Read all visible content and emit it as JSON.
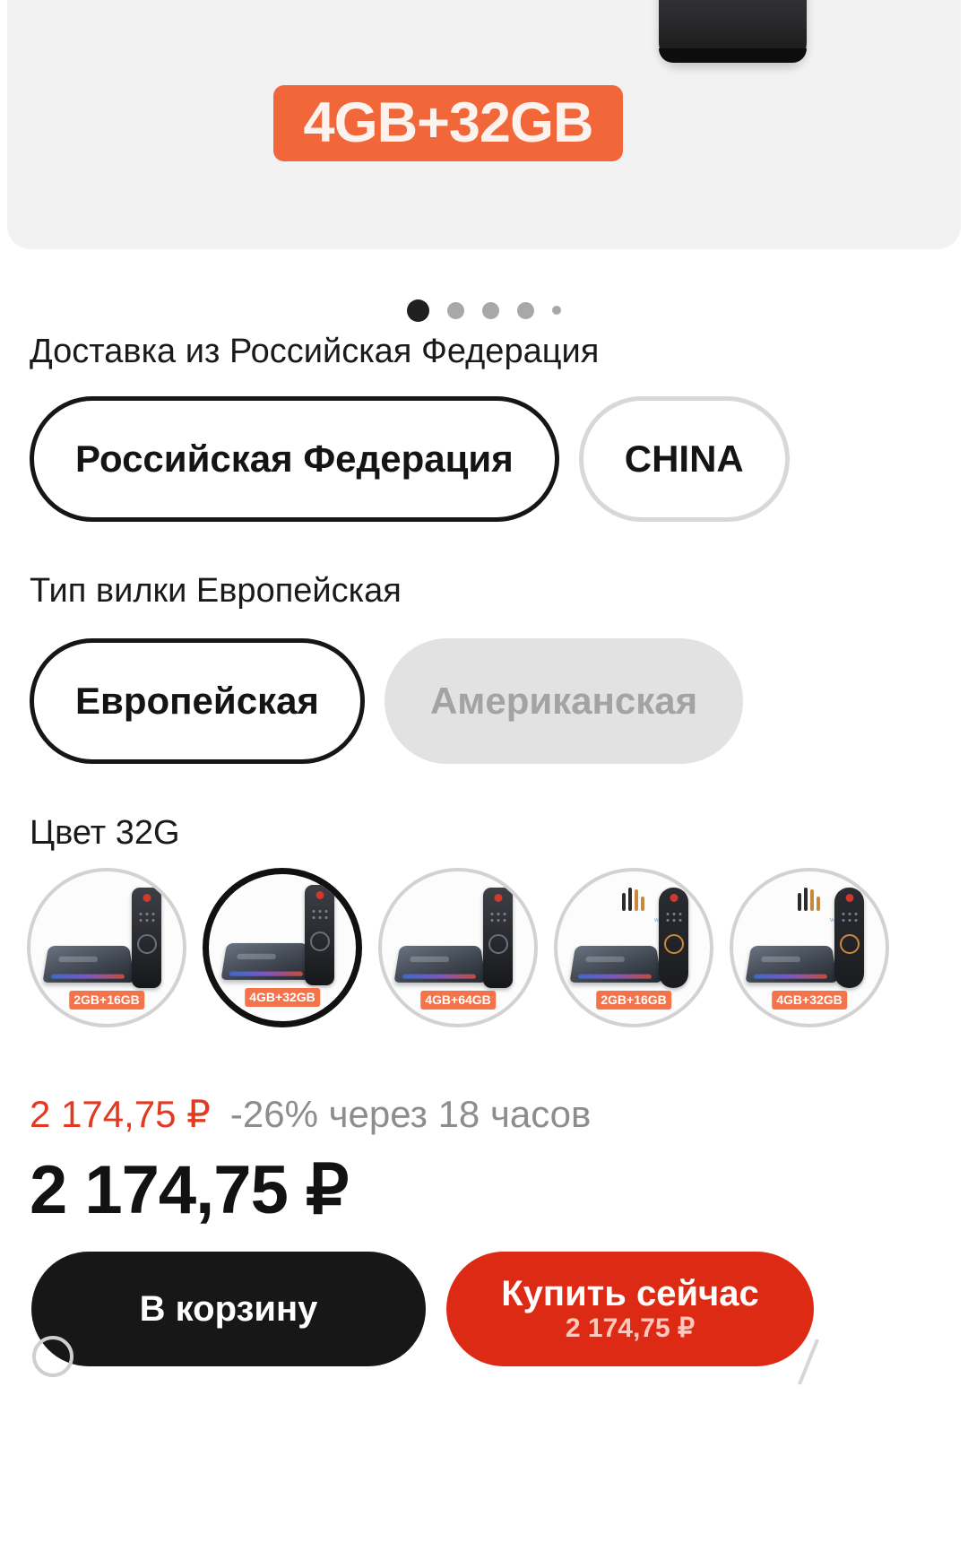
{
  "gallery": {
    "spec_badge": "4GB+32GB",
    "device_icon": "tv-box-device",
    "dots": [
      {
        "state": "active"
      },
      {
        "state": "inactive"
      },
      {
        "state": "inactive"
      },
      {
        "state": "inactive"
      },
      {
        "state": "edge"
      }
    ]
  },
  "delivery": {
    "label": "Доставка из Российская Федерация",
    "options": [
      {
        "label": "Российская Федерация",
        "selected": true,
        "muted": false
      },
      {
        "label": "CHINA",
        "selected": false,
        "muted": false
      }
    ]
  },
  "plug": {
    "label": "Тип вилки Европейская",
    "options": [
      {
        "label": "Европейская",
        "selected": true,
        "muted": false
      },
      {
        "label": "Американская",
        "selected": false,
        "muted": true
      }
    ]
  },
  "color": {
    "label": "Цвет 32G",
    "options": [
      {
        "badge": "2GB+16GB",
        "selected": false,
        "kind": "ir"
      },
      {
        "badge": "4GB+32GB",
        "selected": true,
        "kind": "ir"
      },
      {
        "badge": "4GB+64GB",
        "selected": false,
        "kind": "ir"
      },
      {
        "badge": "2GB+16GB",
        "selected": false,
        "kind": "voice"
      },
      {
        "badge": "4GB+32GB",
        "selected": false,
        "kind": "voice"
      }
    ]
  },
  "price": {
    "promo_price": "2 174,75 ₽",
    "promo_note": "-26% через 18 часов",
    "main_price": "2 174,75 ₽"
  },
  "actions": {
    "cart_label": "В корзину",
    "buy_label": "Купить сейчас",
    "buy_price": "2 174,75 ₽"
  },
  "colors": {
    "accent_orange": "#f2673a",
    "buy_red": "#dd2a14",
    "promo_red": "#e03b22",
    "cart_black": "#171717",
    "muted_gray": "#a3a3a3"
  }
}
